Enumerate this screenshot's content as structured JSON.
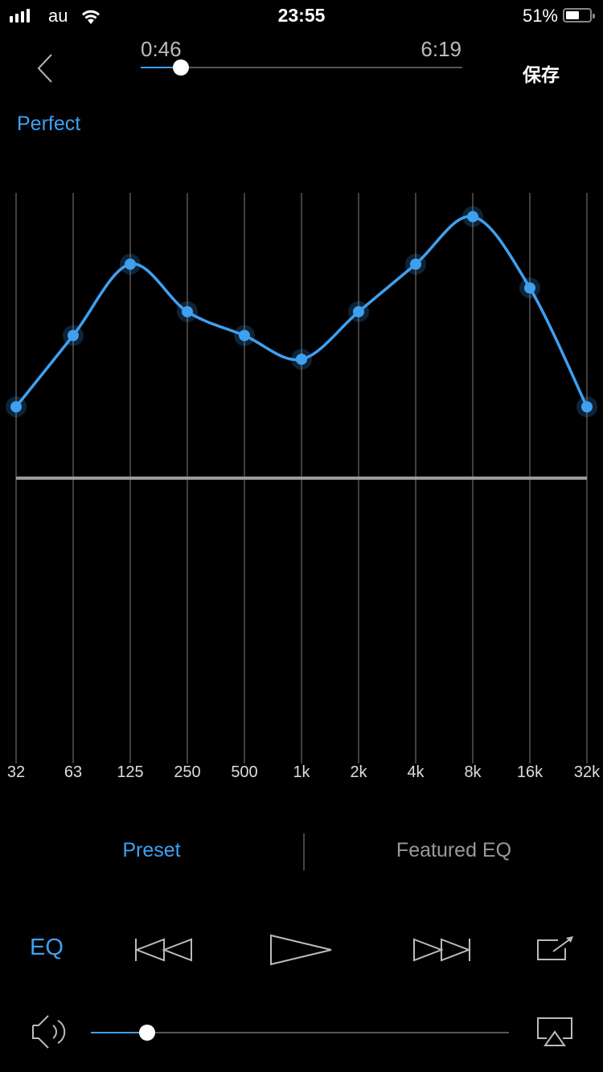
{
  "status_bar": {
    "carrier": "au",
    "time": "23:55",
    "battery_percent": "51%",
    "battery_level": 0.51,
    "signal_bars": 4
  },
  "header": {
    "back_icon": "chevron-left-icon",
    "elapsed": "0:46",
    "duration": "6:19",
    "progress": 0.124,
    "save_label": "保存"
  },
  "preset": {
    "name": "Perfect"
  },
  "chart_data": {
    "type": "line",
    "title": "",
    "xlabel": "",
    "ylabel": "",
    "categories": [
      "32",
      "63",
      "125",
      "250",
      "500",
      "1k",
      "2k",
      "4k",
      "8k",
      "16k",
      "32k"
    ],
    "series": [
      {
        "name": "Perfect",
        "values": [
          3,
          6,
          9,
          7,
          6,
          5,
          7,
          9,
          11,
          8,
          3
        ],
        "color": "#3fa0f0"
      }
    ],
    "ylim": [
      -12,
      12
    ],
    "zero_line": true,
    "grid": "vertical",
    "smooth": true
  },
  "tabs": [
    {
      "label": "Preset",
      "active": true
    },
    {
      "label": "Featured EQ",
      "active": false
    }
  ],
  "controls": {
    "eq_label": "EQ",
    "icons": [
      "previous-icon",
      "play-icon",
      "next-icon",
      "share-icon"
    ]
  },
  "volume": {
    "level": 0.135,
    "speaker_icon": "speaker-icon",
    "airplay_icon": "airplay-icon"
  },
  "colors": {
    "accent": "#3fa0f0",
    "background": "#000000",
    "grid": "#555555",
    "zero_line": "#9a9a9a"
  }
}
